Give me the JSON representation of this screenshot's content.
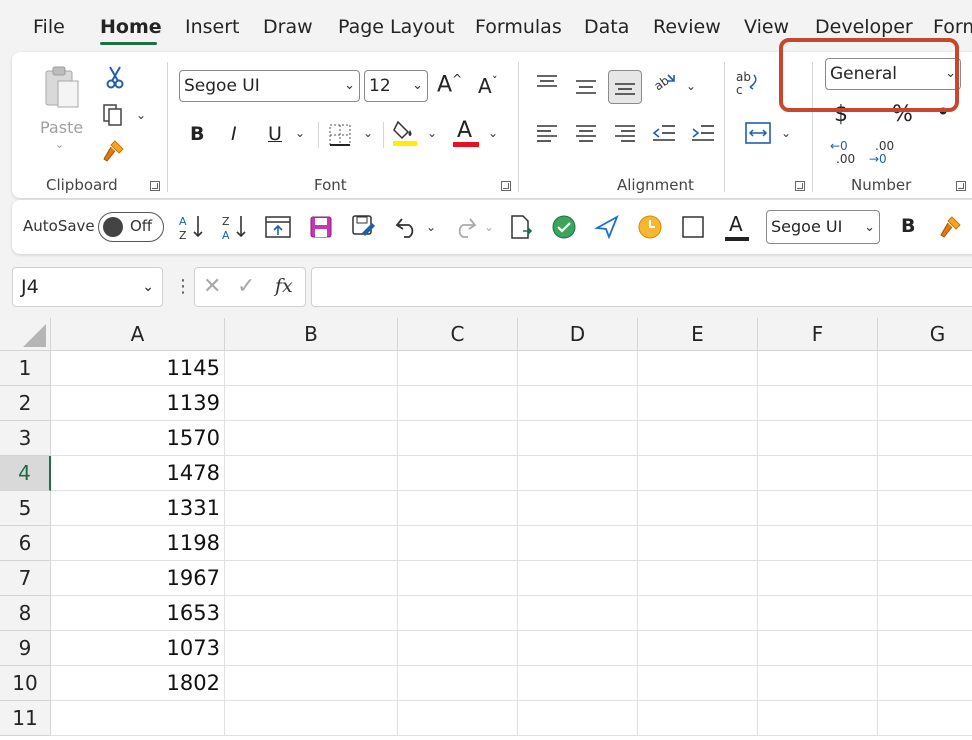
{
  "tabs": [
    "File",
    "Home",
    "Insert",
    "Draw",
    "Page Layout",
    "Formulas",
    "Data",
    "Review",
    "View",
    "Developer",
    "Form"
  ],
  "active_tab": "Home",
  "ribbon": {
    "clipboard": {
      "paste_label": "Paste",
      "group_label": "Clipboard"
    },
    "font": {
      "font_name": "Segoe UI",
      "font_size": "12",
      "group_label": "Font",
      "bold": "B",
      "italic": "I",
      "underline": "U",
      "font_color_letter": "A"
    },
    "alignment": {
      "group_label": "Alignment",
      "wrap_label": "ab"
    },
    "number": {
      "format_value": "General",
      "currency": "$",
      "percent": "%",
      "comma": "•",
      "inc_decimal_top": "←0",
      "inc_decimal_bottom": ".00",
      "dec_decimal_top": ".00",
      "dec_decimal_bottom": "→0",
      "group_label": "Number"
    }
  },
  "qat": {
    "autosave_label": "AutoSave",
    "toggle_state": "Off",
    "font_name": "Segoe UI",
    "bold": "B"
  },
  "formula_bar": {
    "name_box": "J4",
    "fx": "fx",
    "formula": ""
  },
  "sheet": {
    "columns": [
      "A",
      "B",
      "C",
      "D",
      "E",
      "F",
      "G"
    ],
    "rows": [
      "1",
      "2",
      "3",
      "4",
      "5",
      "6",
      "7",
      "8",
      "9",
      "10",
      "11"
    ],
    "selected_row": "4",
    "col_a_values": [
      "1145",
      "1139",
      "1570",
      "1478",
      "1331",
      "1198",
      "1967",
      "1653",
      "1073",
      "1802",
      ""
    ]
  },
  "colors": {
    "accent": "#1e7145",
    "highlight_box": "#c8472b",
    "font_color_bar": "#e81123",
    "highlight_bar": "#ffee00"
  }
}
